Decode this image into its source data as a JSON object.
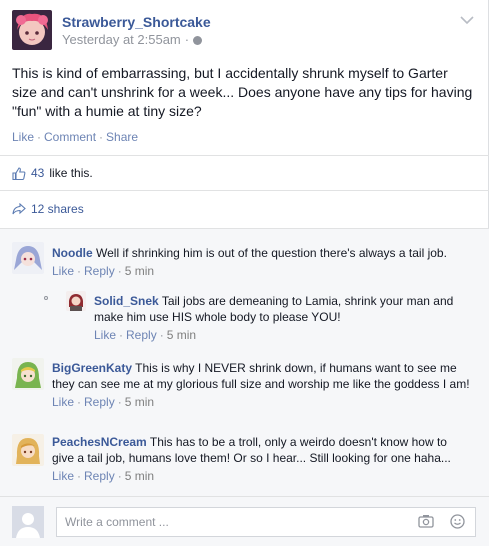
{
  "post": {
    "author": "Strawberry_Shortcake",
    "timestamp": "Yesterday at 2:55am",
    "timestamp_sep": "·",
    "text": "This is kind of embarrassing, but I accidentally shrunk myself to Garter size and can't unshrink for a week... Does anyone have any tips for having \"fun\" with a humie at tiny size?",
    "actions": {
      "like": "Like",
      "comment": "Comment",
      "share": "Share",
      "sep": "·"
    }
  },
  "likes": {
    "count": "43",
    "suffix": "like this."
  },
  "shares": {
    "label": "12 shares"
  },
  "comments": [
    {
      "name": "Noodle",
      "text": "Well if shrinking him is out of the question there's always a tail job.",
      "like": "Like",
      "reply": "Reply",
      "time": "5 min"
    },
    {
      "name": "Solid_Snek",
      "text": "Tail jobs are demeaning to Lamia, shrink your man and make him use HIS whole body to please YOU!",
      "like": "Like",
      "reply": "Reply",
      "time": "5 min"
    },
    {
      "name": "BigGreenKaty",
      "text": "This is why I NEVER shrink down, if humans want to see me they can see me at my glorious full size and worship me like the goddess I am!",
      "like": "Like",
      "reply": "Reply",
      "time": "5 min"
    },
    {
      "name": "PeachesNCream",
      "text": "This has to be a troll, only a weirdo doesn't know how to give a tail job, humans love them! Or so I hear... Still looking for one haha...",
      "like": "Like",
      "reply": "Reply",
      "time": "5 min"
    }
  ],
  "composer": {
    "placeholder": "Write a comment ..."
  },
  "icons": [
    "chevron-down-icon",
    "globe-icon",
    "thumbs-up-icon",
    "share-arrow-icon",
    "camera-icon",
    "smiley-icon"
  ]
}
